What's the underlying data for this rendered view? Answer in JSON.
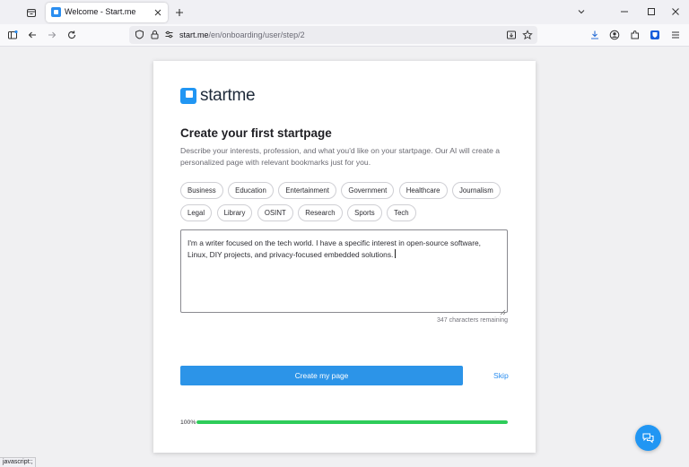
{
  "browser": {
    "tab": {
      "title": "Welcome - Start.me"
    },
    "address": {
      "host": "start.me",
      "path": "/en/onboarding/user/step/2"
    },
    "status_text": "javascript:;"
  },
  "page": {
    "logo_text": "startme",
    "heading": "Create your first startpage",
    "description": "Describe your interests, profession, and what you'd like on your startpage. Our AI will create a personalized page with relevant bookmarks just for you.",
    "chips_row1": [
      "Business",
      "Education",
      "Entertainment",
      "Government",
      "Healthcare",
      "Journalism"
    ],
    "chips_row2": [
      "Legal",
      "Library",
      "OSINT",
      "Research",
      "Sports",
      "Tech"
    ],
    "textarea_value": "I'm a writer focused on the tech world. I have a specific interest in open-source software, Linux, DIY projects, and privacy-focused embedded solutions.",
    "remaining": "347 characters remaining",
    "create_button": "Create my page",
    "skip_link": "Skip",
    "progress": {
      "label": "100%",
      "value": 1.0
    }
  },
  "colors": {
    "accent": "#2c94e8",
    "progress": "#2ecc5a"
  },
  "icons": [
    "tab-list-icon",
    "close-icon",
    "plus-icon",
    "chevron-down-icon",
    "minimize-icon",
    "maximize-icon",
    "sidebar-icon",
    "back-icon",
    "forward-icon",
    "reload-icon",
    "shield-icon",
    "lock-icon",
    "permissions-icon",
    "reader-view-icon",
    "star-icon",
    "download-icon",
    "account-icon",
    "extensions-icon",
    "bitwarden-icon",
    "menu-icon",
    "chat-icon"
  ]
}
